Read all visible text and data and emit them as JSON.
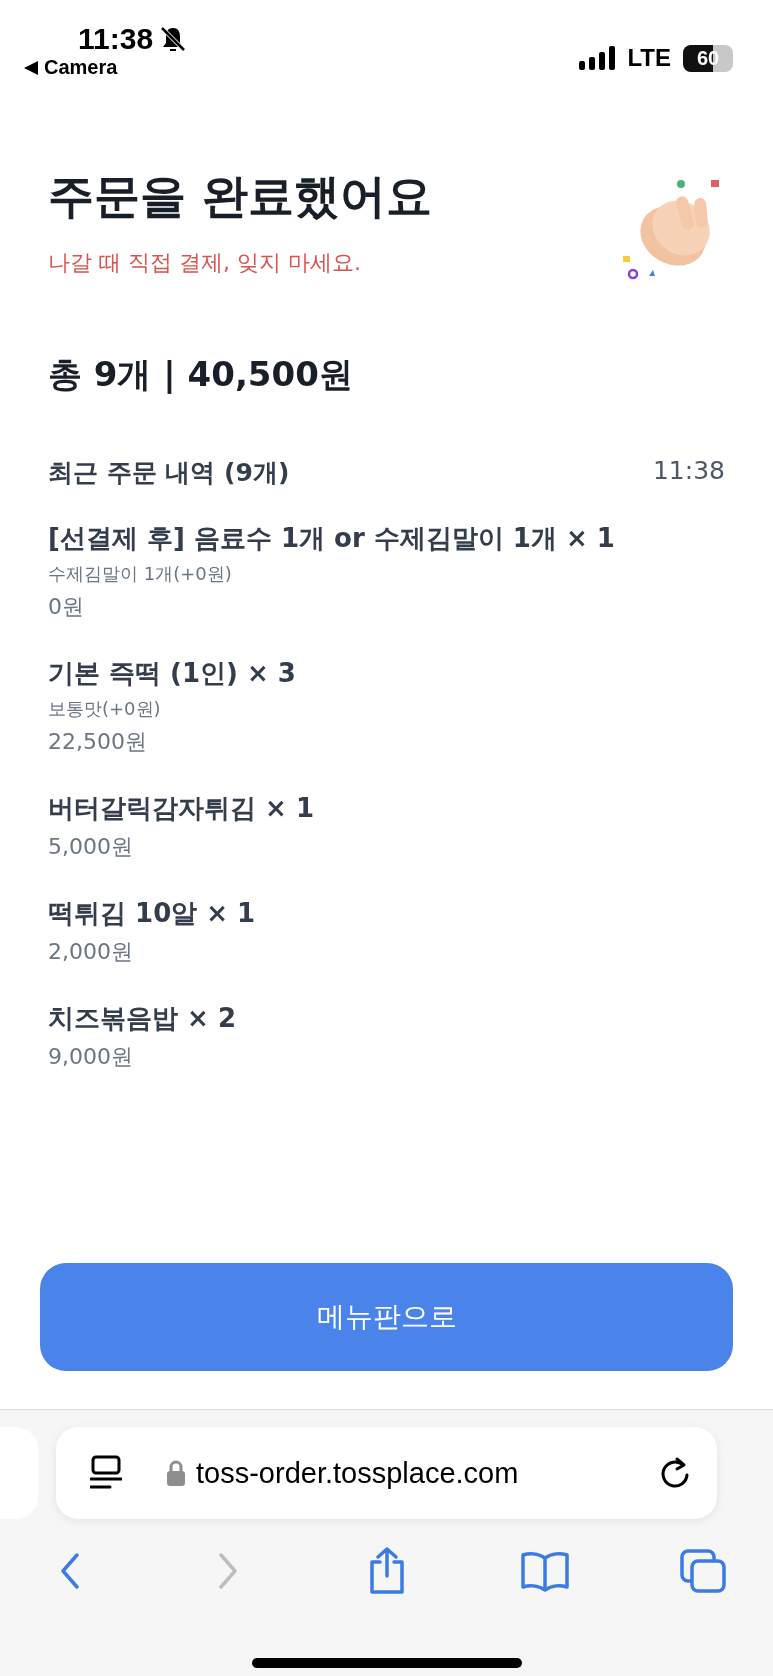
{
  "status_bar": {
    "time": "11:38",
    "back_app": "Camera",
    "network": "LTE",
    "battery": "60"
  },
  "header": {
    "title": "주문을 완료했어요",
    "subtitle": "나갈 때 직접 결제, 잊지 마세요."
  },
  "total": "총 9개 | 40,500원",
  "recent": {
    "title": "최근 주문 내역 (9개)",
    "time": "11:38"
  },
  "items": [
    {
      "name": "[선결제 후] 음료수 1개 or 수제김말이 1개 × 1",
      "option": "수제김말이 1개(+0원)",
      "price": "0원"
    },
    {
      "name": "기본 즉떡 (1인) × 3",
      "option": "보통맛(+0원)",
      "price": "22,500원"
    },
    {
      "name": "버터갈릭감자튀김 × 1",
      "price": "5,000원"
    },
    {
      "name": "떡튀김 10알 × 1",
      "price": "2,000원"
    },
    {
      "name": "치즈볶음밥 × 2",
      "price": "9,000원"
    }
  ],
  "menu_button": "메뉴판으로",
  "browser": {
    "url": "toss-order.tossplace.com",
    "nav": [
      {
        "kind": "back",
        "disabled": false
      },
      {
        "kind": "forward",
        "disabled": true
      },
      {
        "kind": "share",
        "disabled": false
      },
      {
        "kind": "bookmarks",
        "disabled": false
      },
      {
        "kind": "tabs",
        "disabled": false
      }
    ]
  }
}
